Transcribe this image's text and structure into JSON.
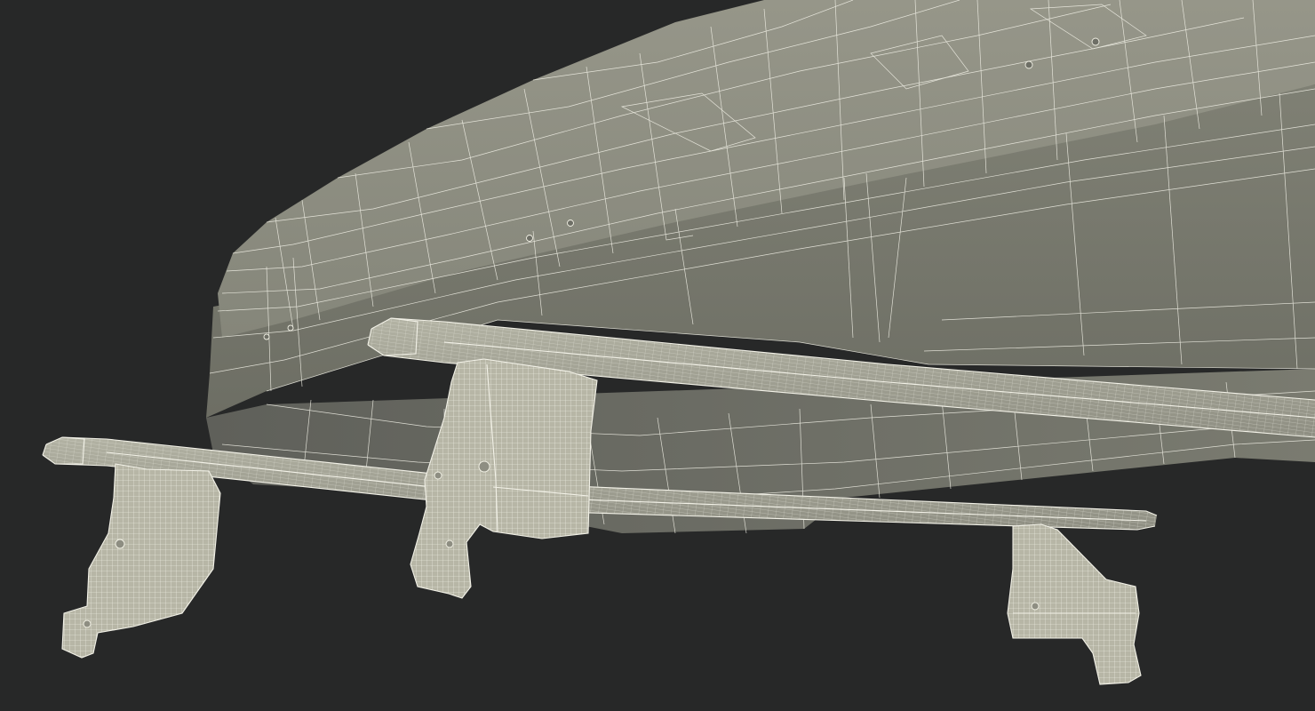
{
  "scene": {
    "subject": "roof-box-on-crossbars-wireframe",
    "colors": {
      "background": "#272828",
      "box_top": "#8c8c80",
      "box_side": "#7d7e72",
      "box_under": "#6f7066",
      "bar": "#a2a294",
      "foot": "#b9b8a8",
      "wire": "#f1f0e4"
    }
  }
}
